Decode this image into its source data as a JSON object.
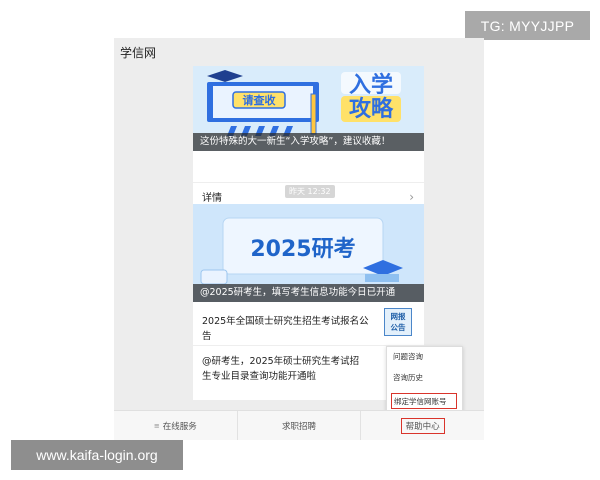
{
  "watermark_top": "TG: MYYJJPP",
  "watermark_bottom": "www.kaifa-login.org",
  "chat": {
    "title": "学信网",
    "card1": {
      "banner_tag": "请查收",
      "banner_title_line1": "入学",
      "banner_title_line2": "攻略",
      "caption": "这份特殊的大一新生“入学攻略”，建议收藏！",
      "detail_label": "详情"
    },
    "timestamp": "昨天 12:32",
    "card2": {
      "banner_title": "2025研考",
      "caption": "@2025研考生，填写考生信息功能今日已开通",
      "article1": "2025年全国硕士研究生招生考试报名公告",
      "thumb_line1": "网报",
      "thumb_line2": "公告",
      "article2": "@研考生，2025年硕士研究生考试招生专业目录查询功能开通啦"
    },
    "popup": {
      "items": [
        "问题咨询",
        "咨询历史",
        "绑定学信网账号"
      ]
    },
    "bottom_nav": [
      "在线服务",
      "求职招聘",
      "帮助中心"
    ]
  }
}
